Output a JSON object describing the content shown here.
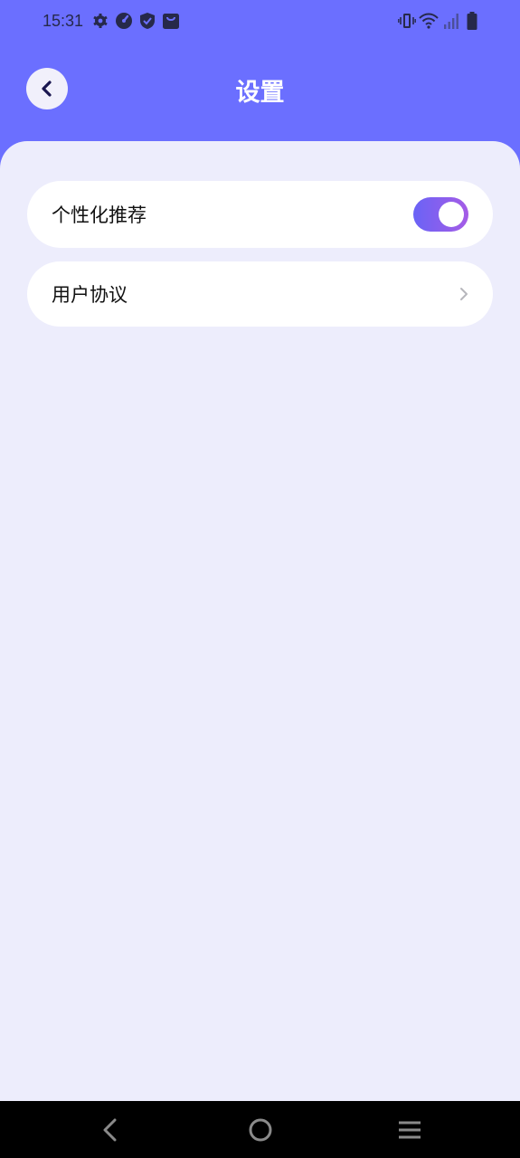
{
  "status_bar": {
    "time": "15:31",
    "left_icons": [
      "settings-gear-icon",
      "data-saver-icon",
      "shield-check-icon",
      "shopping-bag-icon"
    ],
    "right_icons": [
      "vibrate-icon",
      "wifi-icon",
      "signal-icon",
      "battery-icon"
    ]
  },
  "header": {
    "title": "设置",
    "back_icon": "chevron-left-icon"
  },
  "settings": {
    "items": [
      {
        "label": "个性化推荐",
        "control": "toggle",
        "enabled": true
      },
      {
        "label": "用户协议",
        "control": "chevron-right-icon"
      }
    ]
  },
  "nav_bar": {
    "buttons": [
      "back-triangle-icon",
      "home-circle-icon",
      "menu-lines-icon"
    ]
  },
  "colors": {
    "header": "#6b6fff",
    "background": "#ededfc",
    "toggle_start": "#6a63f6",
    "toggle_end": "#a55ce6"
  }
}
